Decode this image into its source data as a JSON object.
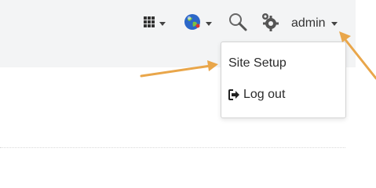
{
  "header": {
    "user_label": "admin"
  },
  "dropdown": {
    "site_setup_label": "Site Setup",
    "logout_label": "Log out"
  },
  "icons": {
    "apps": "grid-icon",
    "language": "globe-icon",
    "search": "search-icon",
    "settings": "gears-icon",
    "logout": "sign-out-icon"
  },
  "colors": {
    "topbar_bg": "#f3f4f5",
    "annotation_arrow": "#e9a64a",
    "text": "#333333"
  }
}
